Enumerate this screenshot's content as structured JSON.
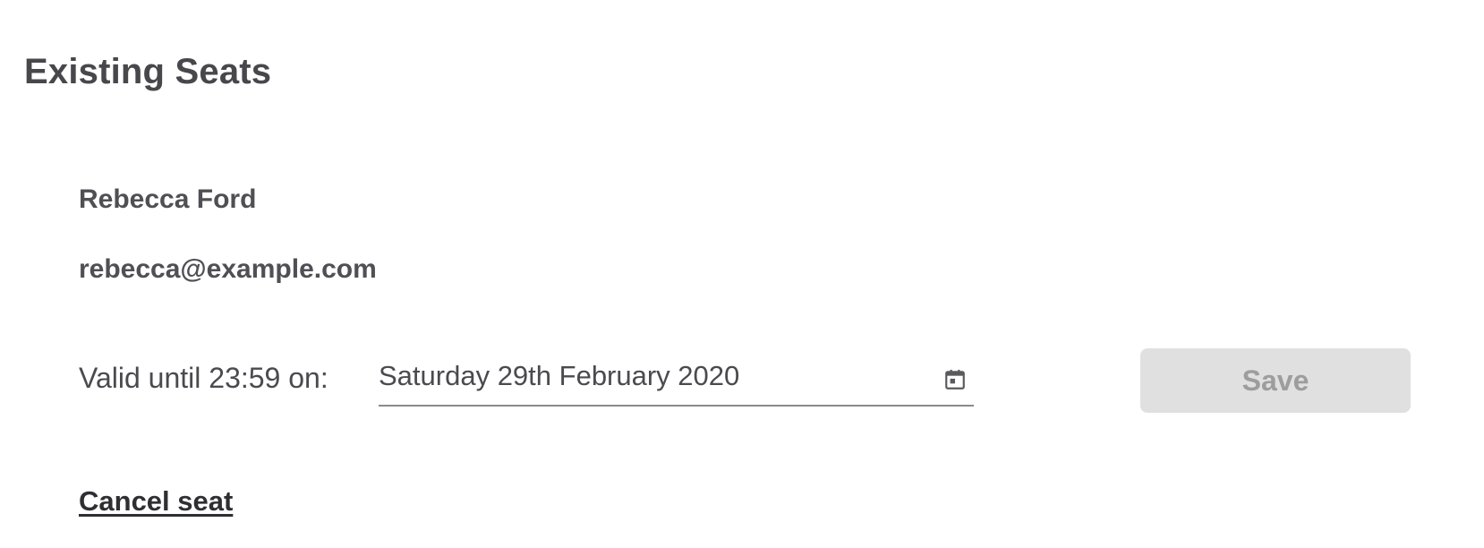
{
  "page": {
    "title": "Existing Seats"
  },
  "seat": {
    "name": "Rebecca Ford",
    "email": "rebecca@example.com",
    "valid_label": "Valid until 23:59 on:",
    "valid_date": "Saturday 29th February 2020",
    "date_icon": "calendar-icon",
    "save_label": "Save",
    "save_disabled": true,
    "cancel_label": "Cancel seat"
  },
  "colors": {
    "title_text": "#47474c",
    "body_text": "#4a4a4f",
    "save_background": "#e0e0e0",
    "save_text": "#9d9d9f",
    "field_underline": "#8a8a8e",
    "link_text": "#2f2f33"
  }
}
